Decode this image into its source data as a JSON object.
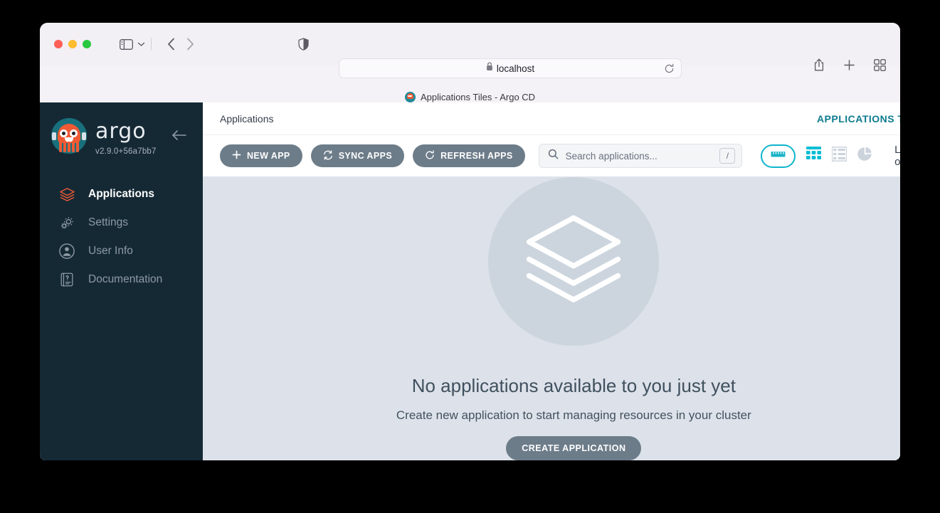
{
  "browser": {
    "url": "localhost",
    "lock_icon": "lock-icon",
    "reload_icon": "reload-icon",
    "shield_icon": "privacy-shield-icon",
    "sidebar_icon": "sidebar-toggle-icon",
    "back_icon": "back-arrow-icon",
    "forward_icon": "forward-arrow-icon",
    "share_icon": "share-icon",
    "newtab_icon": "plus-icon",
    "taboverview_icon": "tab-overview-icon",
    "tab_title": "Applications Tiles - Argo CD"
  },
  "sidebar": {
    "brand": "argo",
    "version": "v2.9.0+56a7bb7",
    "collapse_icon": "left-arrow-icon",
    "items": [
      {
        "label": "Applications",
        "icon": "layers-icon",
        "active": true
      },
      {
        "label": "Settings",
        "icon": "gears-icon",
        "active": false
      },
      {
        "label": "User Info",
        "icon": "user-icon",
        "active": false
      },
      {
        "label": "Documentation",
        "icon": "book-icon",
        "active": false
      }
    ]
  },
  "header": {
    "breadcrumb": "Applications",
    "page_mode": "APPLICATIONS TILES"
  },
  "toolbar": {
    "new_app": "NEW APP",
    "sync_apps": "SYNC APPS",
    "refresh_apps": "REFRESH APPS",
    "search_placeholder": "Search applications...",
    "search_value": "",
    "search_shortcut": "/",
    "logout": "Log out",
    "icons": {
      "new_app": "plus-icon",
      "sync_apps": "sync-icon",
      "refresh_apps": "refresh-icon",
      "search": "search-icon",
      "filter": "filter-icon",
      "tiles_view": "grid-tiles-icon",
      "list_view": "list-view-icon",
      "summary_view": "pie-chart-icon"
    }
  },
  "empty_state": {
    "icon": "stacked-layers-icon",
    "title": "No applications available to you just yet",
    "subtitle": "Create new application to start managing resources in your cluster",
    "button": "CREATE APPLICATION"
  },
  "colors": {
    "sidebar_bg": "#152935",
    "accent_orange": "#ef5a35",
    "accent_teal": "#00bcd4",
    "page_mode_teal": "#0d7b8f",
    "button_slate": "#6d7c89",
    "content_bg": "#dde2ea"
  }
}
